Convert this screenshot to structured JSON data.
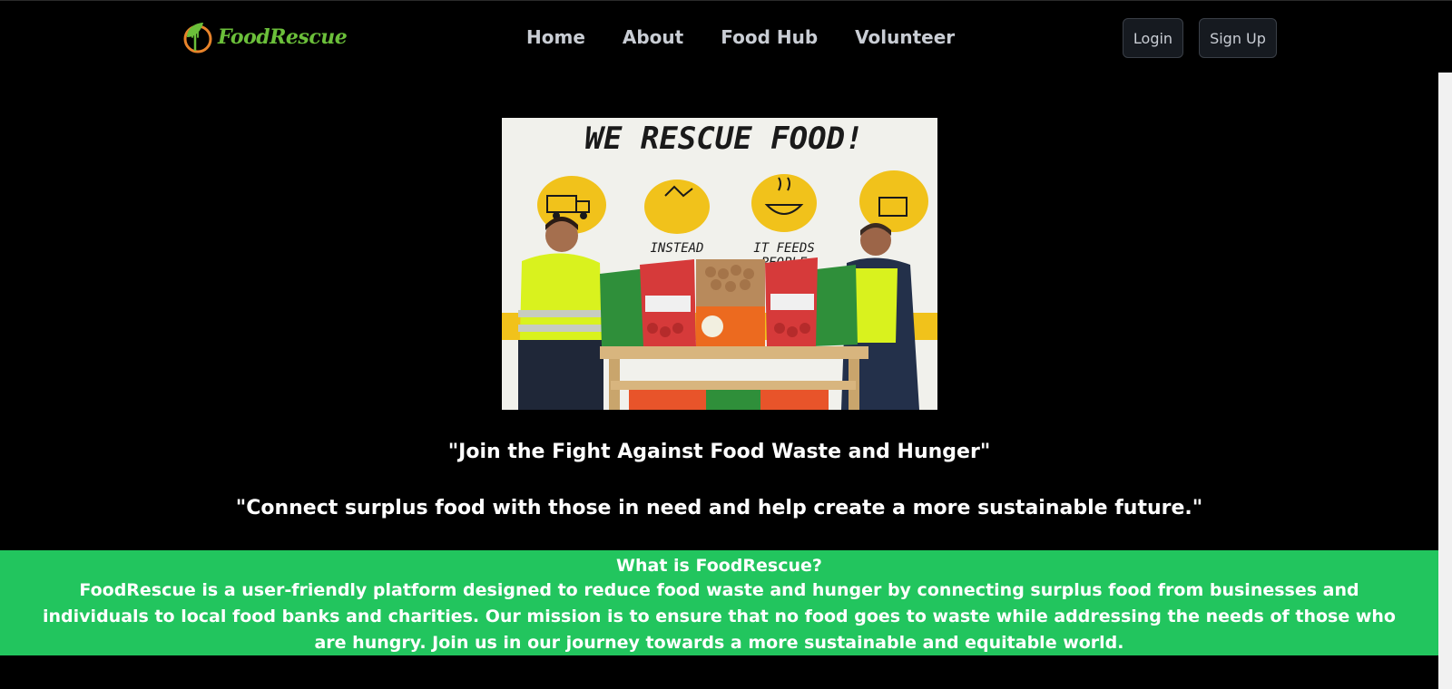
{
  "header": {
    "logo_text": "FoodRescue",
    "nav": [
      "Home",
      "About",
      "Food Hub",
      "Volunteer"
    ],
    "login_label": "Login",
    "signup_label": "Sign Up"
  },
  "hero": {
    "image_sign_title": "WE RESCUE FOOD!",
    "image_sign_captions": [
      "INSTEAD",
      "IT FEEDS",
      "PEOPLE"
    ],
    "tagline_1": "\"Join the Fight Against Food Waste and Hunger\"",
    "tagline_2": "\"Connect surplus food with those in need and help create a more sustainable future.\""
  },
  "about": {
    "title": "What is FoodRescue?",
    "text": "FoodRescue is a user-friendly platform designed to reduce food waste and hunger by connecting surplus food from businesses and individuals to local food banks and charities. Our mission is to ensure that no food goes to waste while addressing the needs of those who are hungry. Join us in our journey towards a more sustainable and equitable world."
  },
  "colors": {
    "accent_green": "#22c55e",
    "logo_green": "#6bbf3a",
    "logo_orange": "#e8832a"
  }
}
